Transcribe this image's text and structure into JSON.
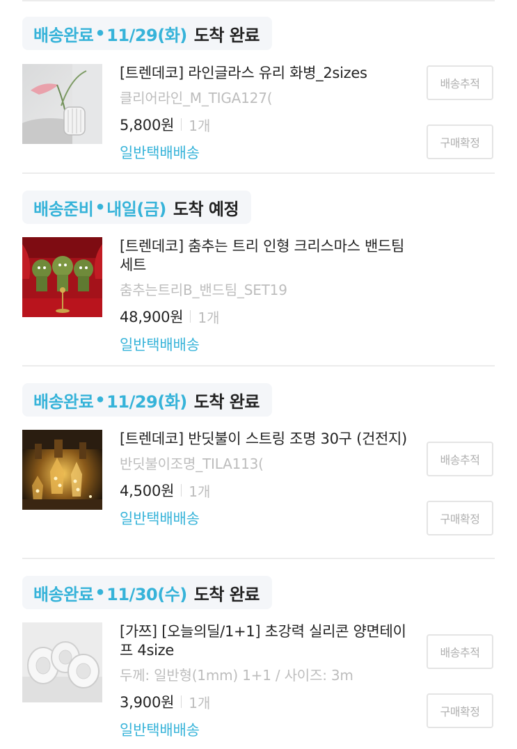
{
  "orders": [
    {
      "status_accent": "배송완료",
      "status_dot": "•",
      "status_date": "11/29(화)",
      "status_rest": "도착 완료",
      "product_name": "[트렌데코] 라인글라스 유리 화병_2sizes",
      "option": "클리어라인_M_TIGA127(",
      "price": "5,800원",
      "qty": "1개",
      "shipping": "일반택배배송",
      "buttons": [
        "배송추적",
        "구매확정"
      ],
      "thumb_icon": "glass-vase-photo"
    },
    {
      "status_accent": "배송준비",
      "status_dot": "•",
      "status_date": "내일(금)",
      "status_rest": "도착 예정",
      "product_name": "[트렌데코] 춤추는 트리 인형 크리스마스 밴드팀 세트",
      "option": "춤추는트리B_밴드팀_SET19",
      "price": "48,900원",
      "qty": "1개",
      "shipping": "일반택배배송",
      "buttons": [],
      "thumb_icon": "dancing-tree-band-photo"
    },
    {
      "status_accent": "배송완료",
      "status_dot": "•",
      "status_date": "11/29(화)",
      "status_rest": "도착 완료",
      "product_name": "[트렌데코] 반딧불이 스트링 조명 30구 (건전지)",
      "option": "반딧불이조명_TILA113(",
      "price": "4,500원",
      "qty": "1개",
      "shipping": "일반택배배송",
      "buttons": [
        "배송추적",
        "구매확정"
      ],
      "thumb_icon": "string-lights-photo"
    },
    {
      "status_accent": "배송완료",
      "status_dot": "•",
      "status_date": "11/30(수)",
      "status_rest": "도착 완료",
      "product_name": "[가쯔] [오늘의딜/1+1] 초강력 실리콘 양면테이프 4size",
      "option": "두께: 일반형(1mm) 1+1 / 사이즈: 3m",
      "price": "3,900원",
      "qty": "1개",
      "shipping": "일반택배배송",
      "buttons": [
        "배송추적",
        "구매확정"
      ],
      "thumb_icon": "tape-rolls-photo"
    }
  ],
  "colors": {
    "accent": "#36b3d9",
    "muted": "#bdbdbd",
    "chip_bg": "#f4f6f9",
    "divider": "#ececec"
  }
}
